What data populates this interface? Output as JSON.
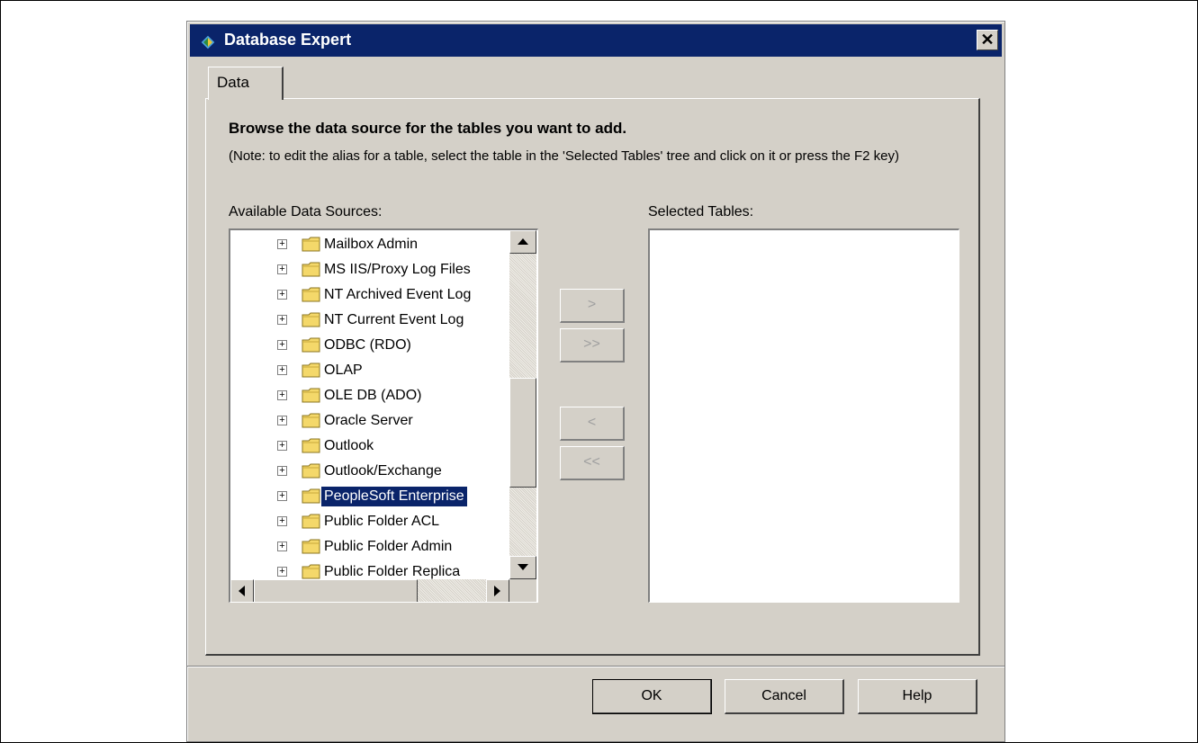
{
  "window": {
    "title": "Database Expert",
    "close_glyph": "✕"
  },
  "tabs": [
    {
      "label": "Data",
      "active": true
    }
  ],
  "panel": {
    "heading": "Browse the data source for the tables you want to add.",
    "note": "(Note: to edit the alias for a table, select the table in the 'Selected Tables' tree and click on it or press the F2 key)",
    "available_label": "Available Data Sources:",
    "selected_label": "Selected Tables:"
  },
  "tree": {
    "items": [
      {
        "label": "Mailbox Admin",
        "selected": false
      },
      {
        "label": "MS IIS/Proxy Log Files",
        "selected": false
      },
      {
        "label": "NT Archived Event Log",
        "selected": false
      },
      {
        "label": "NT Current Event Log",
        "selected": false
      },
      {
        "label": "ODBC (RDO)",
        "selected": false
      },
      {
        "label": "OLAP",
        "selected": false
      },
      {
        "label": "OLE DB (ADO)",
        "selected": false
      },
      {
        "label": "Oracle Server",
        "selected": false
      },
      {
        "label": "Outlook",
        "selected": false
      },
      {
        "label": "Outlook/Exchange",
        "selected": false
      },
      {
        "label": "PeopleSoft Enterprise",
        "selected": true
      },
      {
        "label": "Public Folder ACL",
        "selected": false
      },
      {
        "label": "Public Folder Admin",
        "selected": false
      },
      {
        "label": "Public Folder Replica",
        "selected": false
      }
    ],
    "expander_glyph": "+",
    "icon": "folder-icon"
  },
  "move_buttons": {
    "add_one": ">",
    "add_all": ">>",
    "remove_one": "<",
    "remove_all": "<<"
  },
  "selected_tables": [],
  "footer": {
    "ok": "OK",
    "cancel": "Cancel",
    "help": "Help"
  },
  "colors": {
    "titlebar": "#0a246a",
    "dialog_bg": "#d4d0c8",
    "selection": "#0a246a"
  }
}
